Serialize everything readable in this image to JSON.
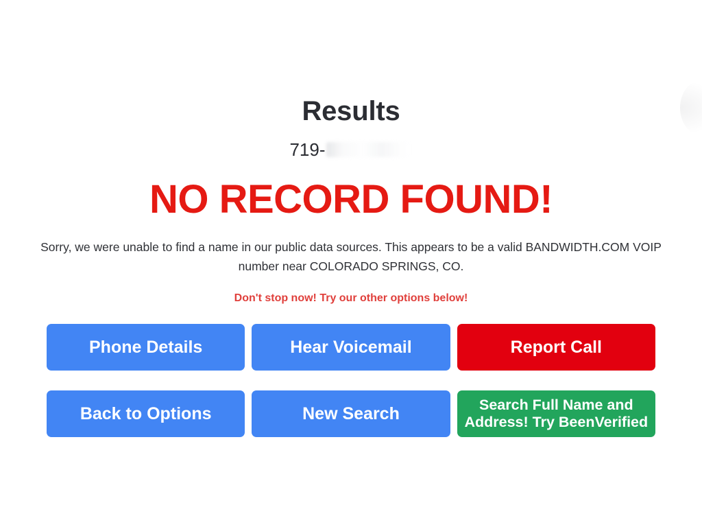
{
  "header": {
    "title": "Results"
  },
  "query": {
    "phone_prefix": "719-",
    "phone_redacted": true
  },
  "result": {
    "status_headline": "NO RECORD FOUND!",
    "status_color": "#e51a13",
    "explanation": "Sorry, we were unable to find a name in our public data sources. This appears to be a valid BANDWIDTH.COM VOIP number near COLORADO SPRINGS, CO.",
    "carrier": "BANDWIDTH.COM",
    "line_type": "VOIP",
    "location": "COLORADO SPRINGS, CO",
    "cta_line": "Don't stop now! Try our other options below!",
    "cta_color": "#e0403c"
  },
  "actions": {
    "buttons": [
      {
        "label": "Phone Details",
        "style": "blue",
        "color": "#4285f4",
        "lines": 1
      },
      {
        "label": "Hear Voicemail",
        "style": "blue",
        "color": "#4285f4",
        "lines": 1
      },
      {
        "label": "Report Call",
        "style": "red",
        "color": "#e2000f",
        "lines": 1
      },
      {
        "label": "Back to Options",
        "style": "blue",
        "color": "#4285f4",
        "lines": 1
      },
      {
        "label": "New Search",
        "style": "blue",
        "color": "#4285f4",
        "lines": 1
      },
      {
        "label": "Search Full Name and Address! Try BeenVerified",
        "style": "green",
        "color": "#22a55c",
        "lines": 2
      }
    ]
  }
}
